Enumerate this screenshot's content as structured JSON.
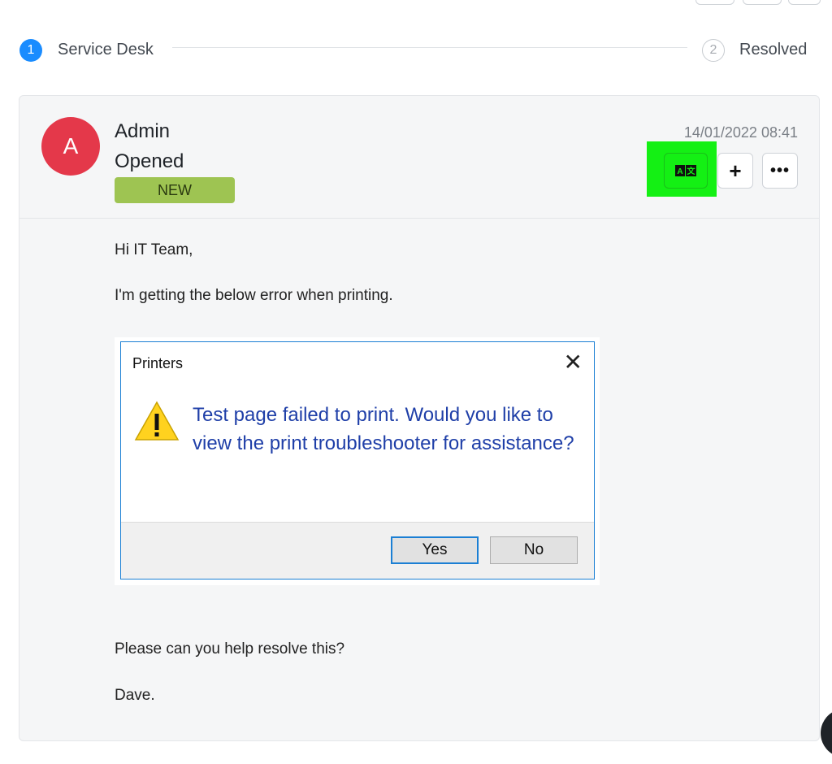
{
  "stepper": {
    "steps": [
      {
        "number": "1",
        "label": "Service Desk"
      },
      {
        "number": "2",
        "label": "Resolved"
      }
    ]
  },
  "ticket": {
    "avatar_letter": "A",
    "author": "Admin",
    "status": "Opened",
    "badge": "NEW",
    "timestamp": "14/01/2022 08:41",
    "actions": {
      "translate_icon": "translate-icon",
      "add_label": "+",
      "more_label": "•••"
    },
    "colors": {
      "avatar": "#e4384a",
      "badge": "#9ec452",
      "highlight": "#14f014",
      "step_active": "#1a8cff"
    },
    "message": {
      "greeting": "Hi IT Team,",
      "line1": "I'm getting the below error when printing.",
      "line2": "Please can you help resolve this?",
      "signoff": "Dave."
    },
    "screenshot": {
      "title": "Printers",
      "close": "✕",
      "text": "Test page failed to print. Would you like to view the print troubleshooter for assistance?",
      "yes_label": "Yes",
      "no_label": "No"
    }
  }
}
